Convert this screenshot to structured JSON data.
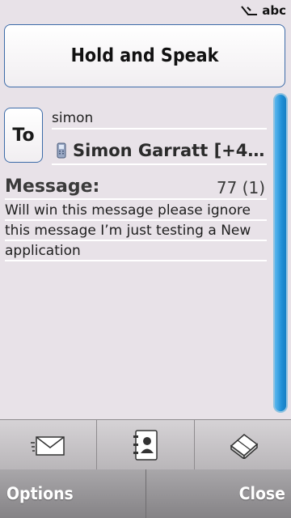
{
  "status_bar": {
    "input_mode": "abc",
    "input_mode_icon": "pen-input-icon"
  },
  "speak_button": {
    "label": "Hold and Speak"
  },
  "recipient": {
    "to_button_label": "To",
    "typed_text": "simon",
    "contact_icon": "mobile-phone-icon",
    "contact_name": "Simon Garratt [+4…"
  },
  "message": {
    "label": "Message:",
    "char_count": "77 (1)",
    "body": "Will win this message please ignore this message I’m just testing a New application"
  },
  "toolbar": {
    "items": [
      {
        "name": "send",
        "icon": "envelope-icon"
      },
      {
        "name": "contacts",
        "icon": "contacts-book-icon"
      },
      {
        "name": "clear",
        "icon": "eraser-icon"
      }
    ]
  },
  "softkeys": {
    "left": "Options",
    "right": "Close"
  },
  "colors": {
    "background": "#e8e2e8",
    "button_border": "#3c6ba8",
    "scrollbar": "#1f8fd6",
    "softkey_bar": "#969497"
  }
}
